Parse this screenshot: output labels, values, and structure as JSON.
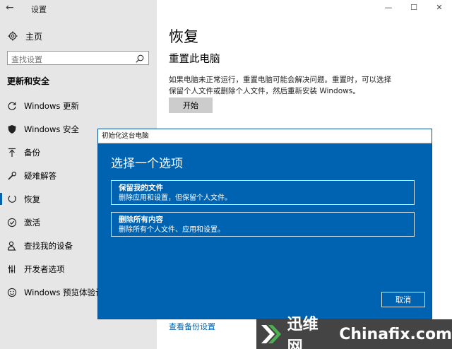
{
  "window": {
    "title": "设置",
    "back_glyph": "←",
    "minimize": "—",
    "maximize": "☐",
    "close": "✕"
  },
  "sidebar": {
    "home_label": "主页",
    "search_placeholder": "查找设置",
    "section_title": "更新和安全",
    "items": [
      {
        "label": "Windows 更新",
        "icon": "refresh-icon"
      },
      {
        "label": "Windows 安全",
        "icon": "shield-icon"
      },
      {
        "label": "备份",
        "icon": "backup-arrow-icon"
      },
      {
        "label": "疑难解答",
        "icon": "wrench-icon"
      },
      {
        "label": "恢复",
        "icon": "recovery-icon",
        "active": true
      },
      {
        "label": "激活",
        "icon": "checkmark-circle-icon"
      },
      {
        "label": "查找我的设备",
        "icon": "person-location-icon"
      },
      {
        "label": "开发者选项",
        "icon": "developer-icon"
      },
      {
        "label": "Windows 预览体验计划",
        "icon": "smiley-icon"
      }
    ]
  },
  "main": {
    "title": "恢复",
    "subsection": "重置此电脑",
    "description": "如果电脑未正常运行，重置电脑可能会解决问题。重置时，可以选择保留个人文件或删除个人文件，然后重新安装 Windows。",
    "start_button": "开始",
    "backup_link": "查看备份设置"
  },
  "dialog": {
    "title": "初始化这台电脑",
    "heading": "选择一个选项",
    "options": [
      {
        "title": "保留我的文件",
        "desc": "删除应用和设置，但保留个人文件。"
      },
      {
        "title": "删除所有内容",
        "desc": "删除所有个人文件、应用和设置。"
      }
    ],
    "cancel_button": "取消"
  },
  "watermark": {
    "text1": "迅维网",
    "text2": "Chinafix.com"
  },
  "colors": {
    "accent": "#0063b1",
    "sidebar_bg": "#e6e6e6",
    "watermark_bg": "#444444"
  }
}
